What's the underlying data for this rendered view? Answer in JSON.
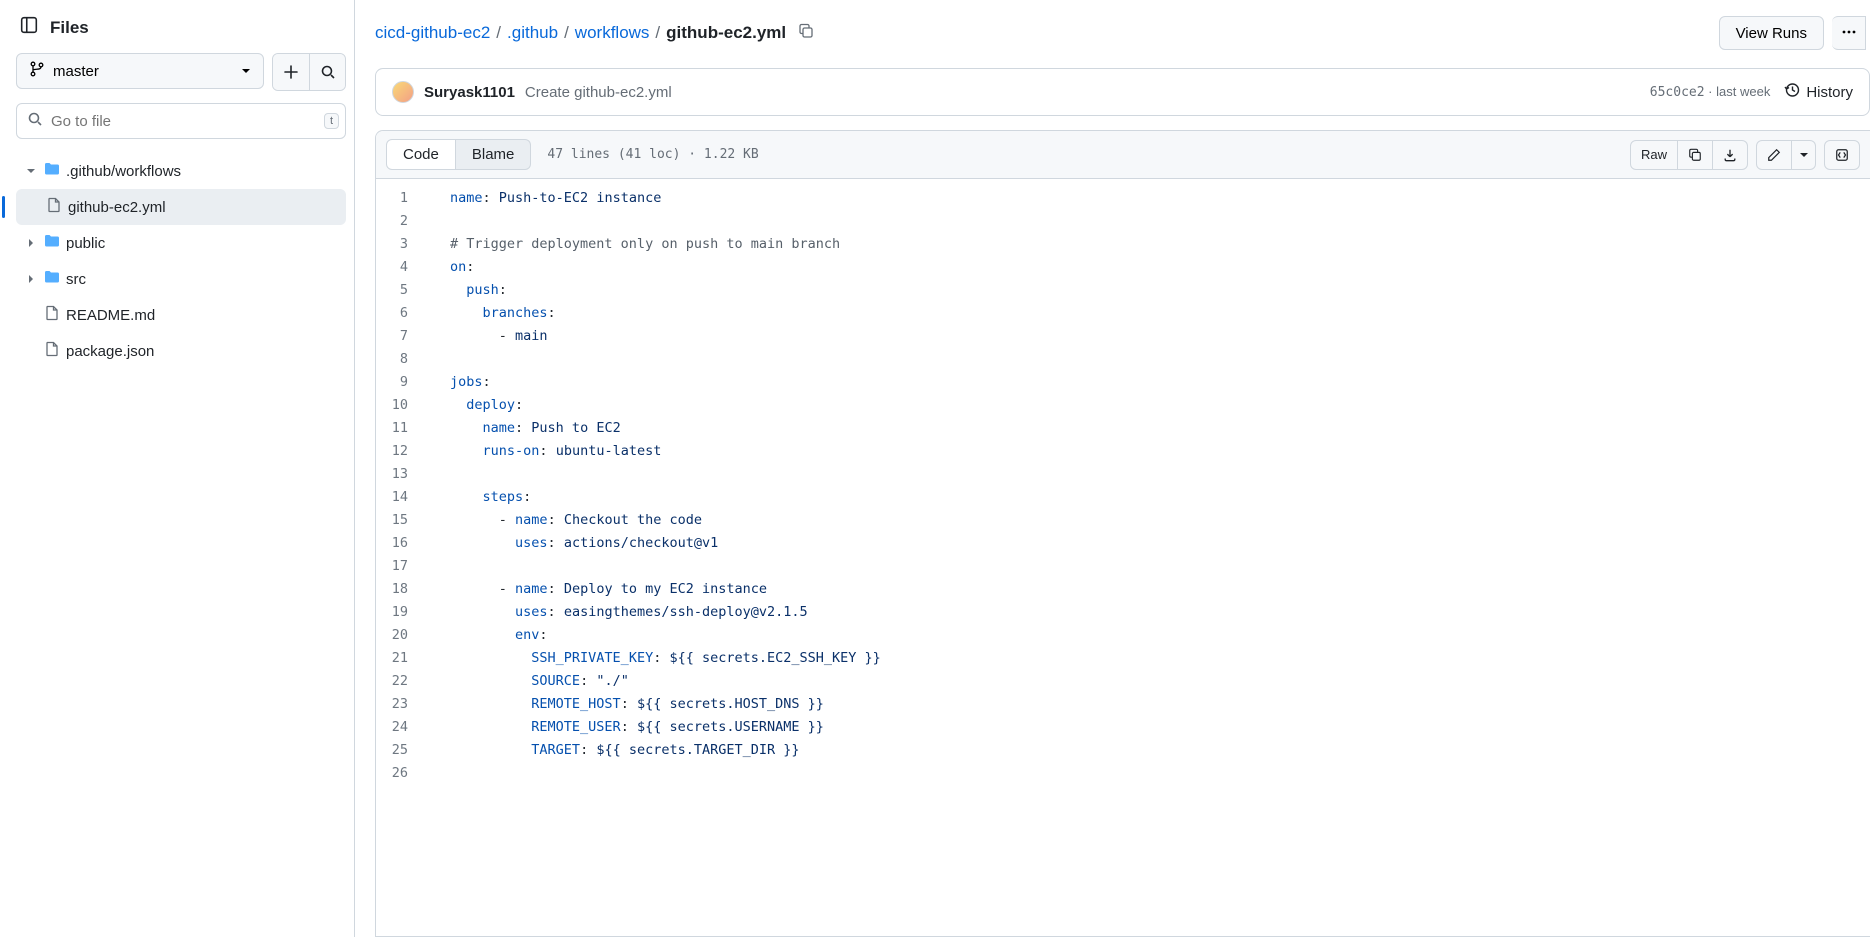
{
  "sidebar": {
    "title": "Files",
    "branch": "master",
    "search_placeholder": "Go to file",
    "search_key": "t",
    "tree": {
      "workflows": ".github/workflows",
      "file_selected": "github-ec2.yml",
      "public": "public",
      "src": "src",
      "readme": "README.md",
      "package": "package.json"
    }
  },
  "breadcrumb": {
    "repo": "cicd-github-ec2",
    "p1": ".github",
    "p2": "workflows",
    "current": "github-ec2.yml"
  },
  "top": {
    "view_runs": "View Runs"
  },
  "commit": {
    "author": "Suryask1101",
    "message": "Create github-ec2.yml",
    "hash": "65c0ce2",
    "time": "last week",
    "history": "History"
  },
  "file": {
    "code_tab": "Code",
    "blame_tab": "Blame",
    "info": "47 lines (41 loc) · 1.22 KB",
    "raw": "Raw"
  },
  "code": {
    "lines": [
      {
        "type": "kv",
        "indent": 0,
        "key": "name",
        "val": "Push-to-EC2 instance"
      },
      {
        "type": "blank"
      },
      {
        "type": "comment",
        "text": "# Trigger deployment only on push to main branch"
      },
      {
        "type": "key",
        "indent": 0,
        "key": "on"
      },
      {
        "type": "key",
        "indent": 1,
        "key": "push"
      },
      {
        "type": "key",
        "indent": 2,
        "key": "branches"
      },
      {
        "type": "item",
        "indent": 3,
        "val": "main"
      },
      {
        "type": "blank"
      },
      {
        "type": "key",
        "indent": 0,
        "key": "jobs"
      },
      {
        "type": "key",
        "indent": 1,
        "key": "deploy"
      },
      {
        "type": "kv",
        "indent": 2,
        "key": "name",
        "val": "Push to EC2"
      },
      {
        "type": "kv",
        "indent": 2,
        "key": "runs-on",
        "val": "ubuntu-latest"
      },
      {
        "type": "blank"
      },
      {
        "type": "key",
        "indent": 2,
        "key": "steps"
      },
      {
        "type": "dashkv",
        "indent": 3,
        "key": "name",
        "val": "Checkout the code"
      },
      {
        "type": "kv",
        "indent": 4,
        "key": "uses",
        "val": "actions/checkout@v1"
      },
      {
        "type": "blank"
      },
      {
        "type": "dashkv",
        "indent": 3,
        "key": "name",
        "val": "Deploy to my EC2 instance"
      },
      {
        "type": "kv",
        "indent": 4,
        "key": "uses",
        "val": "easingthemes/ssh-deploy@v2.1.5"
      },
      {
        "type": "key",
        "indent": 4,
        "key": "env"
      },
      {
        "type": "kv",
        "indent": 5,
        "key": "SSH_PRIVATE_KEY",
        "val": "${{ secrets.EC2_SSH_KEY }}"
      },
      {
        "type": "kv",
        "indent": 5,
        "key": "SOURCE",
        "val": "\"./\""
      },
      {
        "type": "kv",
        "indent": 5,
        "key": "REMOTE_HOST",
        "val": "${{ secrets.HOST_DNS }}"
      },
      {
        "type": "kv",
        "indent": 5,
        "key": "REMOTE_USER",
        "val": "${{ secrets.USERNAME }}"
      },
      {
        "type": "kv",
        "indent": 5,
        "key": "TARGET",
        "val": "${{ secrets.TARGET_DIR }}"
      }
    ]
  }
}
